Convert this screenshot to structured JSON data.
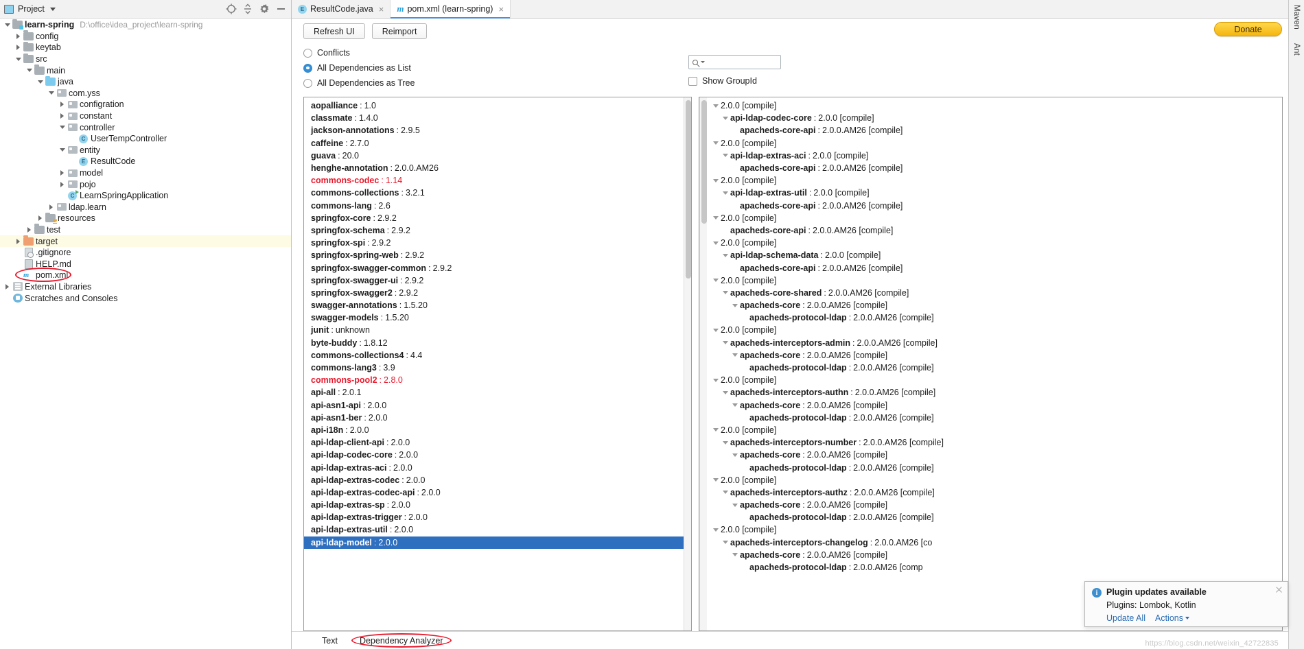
{
  "project_panel": {
    "header": {
      "title": "Project",
      "dropdown_icon": "chevron-down-icon",
      "locate_icon": "locate-icon",
      "collapse_icon": "collapse-all-icon",
      "settings_icon": "gear-icon",
      "hide_icon": "minimize-icon"
    },
    "tree": [
      {
        "label": "learn-spring",
        "path": "D:\\office\\idea_project\\learn-spring",
        "indent": 0,
        "twisty": "open",
        "icon": "module-folder-icon",
        "bold": true,
        "highlight": false
      },
      {
        "label": "config",
        "indent": 1,
        "twisty": "closed",
        "icon": "folder-grey-icon",
        "bold": false,
        "highlight": false
      },
      {
        "label": "keytab",
        "indent": 1,
        "twisty": "closed",
        "icon": "folder-grey-icon",
        "bold": false,
        "highlight": false
      },
      {
        "label": "src",
        "indent": 1,
        "twisty": "open",
        "icon": "folder-grey-icon",
        "bold": false,
        "highlight": false
      },
      {
        "label": "main",
        "indent": 2,
        "twisty": "open",
        "icon": "folder-grey-icon",
        "bold": false,
        "highlight": false
      },
      {
        "label": "java",
        "indent": 3,
        "twisty": "open",
        "icon": "folder-source-icon",
        "bold": false,
        "highlight": false
      },
      {
        "label": "com.yss",
        "indent": 4,
        "twisty": "open",
        "icon": "package-icon",
        "bold": false,
        "highlight": false
      },
      {
        "label": "configration",
        "indent": 5,
        "twisty": "closed",
        "icon": "package-icon",
        "bold": false,
        "highlight": false
      },
      {
        "label": "constant",
        "indent": 5,
        "twisty": "closed",
        "icon": "package-icon",
        "bold": false,
        "highlight": false
      },
      {
        "label": "controller",
        "indent": 5,
        "twisty": "open",
        "icon": "package-icon",
        "bold": false,
        "highlight": false
      },
      {
        "label": "UserTempController",
        "indent": 6,
        "twisty": "none",
        "icon": "class-icon",
        "bold": false,
        "highlight": false
      },
      {
        "label": "entity",
        "indent": 5,
        "twisty": "open",
        "icon": "package-icon",
        "bold": false,
        "highlight": false
      },
      {
        "label": "ResultCode",
        "indent": 6,
        "twisty": "none",
        "icon": "enum-icon",
        "bold": false,
        "highlight": false
      },
      {
        "label": "model",
        "indent": 5,
        "twisty": "closed",
        "icon": "package-icon",
        "bold": false,
        "highlight": false
      },
      {
        "label": "pojo",
        "indent": 5,
        "twisty": "closed",
        "icon": "package-icon",
        "bold": false,
        "highlight": false
      },
      {
        "label": "LearnSpringApplication",
        "indent": 5,
        "twisty": "none",
        "icon": "runnable-class-icon",
        "bold": false,
        "highlight": false
      },
      {
        "label": "ldap.learn",
        "indent": 4,
        "twisty": "closed",
        "icon": "package-icon",
        "bold": false,
        "highlight": false
      },
      {
        "label": "resources",
        "indent": 3,
        "twisty": "closed",
        "icon": "folder-resources-icon",
        "bold": false,
        "highlight": false
      },
      {
        "label": "test",
        "indent": 2,
        "twisty": "closed",
        "icon": "folder-grey-icon",
        "bold": false,
        "highlight": false
      },
      {
        "label": "target",
        "indent": 1,
        "twisty": "closed",
        "icon": "folder-excluded-icon",
        "bold": false,
        "highlight": true
      },
      {
        "label": ".gitignore",
        "indent": 1,
        "twisty": "none",
        "icon": "gitignore-file-icon",
        "bold": false,
        "highlight": false
      },
      {
        "label": "HELP.md",
        "indent": 1,
        "twisty": "none",
        "icon": "markdown-file-icon",
        "bold": false,
        "highlight": false
      },
      {
        "label": "pom.xml",
        "indent": 1,
        "twisty": "none",
        "icon": "maven-file-icon",
        "bold": false,
        "highlight": false,
        "annotated": true
      },
      {
        "label": "External Libraries",
        "indent": 0,
        "twisty": "closed",
        "icon": "library-icon",
        "bold": false,
        "highlight": false
      },
      {
        "label": "Scratches and Consoles",
        "indent": 0,
        "twisty": "none",
        "icon": "scratches-icon",
        "bold": false,
        "highlight": false
      }
    ]
  },
  "editor": {
    "tabs": [
      {
        "label": "ResultCode.java",
        "icon": "enum-file-icon",
        "active": false,
        "closable": true
      },
      {
        "label": "pom.xml (learn-spring)",
        "icon": "maven-file-icon",
        "active": true,
        "closable": true
      }
    ]
  },
  "maven_toolbar": {
    "refresh_label": "Refresh UI",
    "reimport_label": "Reimport",
    "donate_label": "Donate",
    "search_placeholder": "",
    "search_value": "",
    "search_icon": "search-icon",
    "radios": [
      {
        "label": "Conflicts",
        "selected": false
      },
      {
        "label": "All Dependencies as List",
        "selected": true
      },
      {
        "label": "All Dependencies as Tree",
        "selected": false
      }
    ],
    "checkbox": {
      "label": "Show GroupId",
      "checked": false
    }
  },
  "dependency_list": [
    {
      "name": "aopalliance",
      "version": "1.0",
      "conflict": false,
      "selected": false
    },
    {
      "name": "classmate",
      "version": "1.4.0",
      "conflict": false,
      "selected": false
    },
    {
      "name": "jackson-annotations",
      "version": "2.9.5",
      "conflict": false,
      "selected": false
    },
    {
      "name": "caffeine",
      "version": "2.7.0",
      "conflict": false,
      "selected": false
    },
    {
      "name": "guava",
      "version": "20.0",
      "conflict": false,
      "selected": false
    },
    {
      "name": "henghe-annotation",
      "version": "2.0.0.AM26",
      "conflict": false,
      "selected": false
    },
    {
      "name": "commons-codec",
      "version": "1.14",
      "conflict": true,
      "selected": false
    },
    {
      "name": "commons-collections",
      "version": "3.2.1",
      "conflict": false,
      "selected": false
    },
    {
      "name": "commons-lang",
      "version": "2.6",
      "conflict": false,
      "selected": false
    },
    {
      "name": "springfox-core",
      "version": "2.9.2",
      "conflict": false,
      "selected": false
    },
    {
      "name": "springfox-schema",
      "version": "2.9.2",
      "conflict": false,
      "selected": false
    },
    {
      "name": "springfox-spi",
      "version": "2.9.2",
      "conflict": false,
      "selected": false
    },
    {
      "name": "springfox-spring-web",
      "version": "2.9.2",
      "conflict": false,
      "selected": false
    },
    {
      "name": "springfox-swagger-common",
      "version": "2.9.2",
      "conflict": false,
      "selected": false
    },
    {
      "name": "springfox-swagger-ui",
      "version": "2.9.2",
      "conflict": false,
      "selected": false
    },
    {
      "name": "springfox-swagger2",
      "version": "2.9.2",
      "conflict": false,
      "selected": false
    },
    {
      "name": "swagger-annotations",
      "version": "1.5.20",
      "conflict": false,
      "selected": false
    },
    {
      "name": "swagger-models",
      "version": "1.5.20",
      "conflict": false,
      "selected": false
    },
    {
      "name": "junit",
      "version": "unknown",
      "conflict": false,
      "selected": false
    },
    {
      "name": "byte-buddy",
      "version": "1.8.12",
      "conflict": false,
      "selected": false
    },
    {
      "name": "commons-collections4",
      "version": "4.4",
      "conflict": false,
      "selected": false
    },
    {
      "name": "commons-lang3",
      "version": "3.9",
      "conflict": false,
      "selected": false
    },
    {
      "name": "commons-pool2",
      "version": "2.8.0",
      "conflict": true,
      "selected": false
    },
    {
      "name": "api-all",
      "version": "2.0.1",
      "conflict": false,
      "selected": false
    },
    {
      "name": "api-asn1-api",
      "version": "2.0.0",
      "conflict": false,
      "selected": false
    },
    {
      "name": "api-asn1-ber",
      "version": "2.0.0",
      "conflict": false,
      "selected": false
    },
    {
      "name": "api-i18n",
      "version": "2.0.0",
      "conflict": false,
      "selected": false
    },
    {
      "name": "api-ldap-client-api",
      "version": "2.0.0",
      "conflict": false,
      "selected": false
    },
    {
      "name": "api-ldap-codec-core",
      "version": "2.0.0",
      "conflict": false,
      "selected": false
    },
    {
      "name": "api-ldap-extras-aci",
      "version": "2.0.0",
      "conflict": false,
      "selected": false
    },
    {
      "name": "api-ldap-extras-codec",
      "version": "2.0.0",
      "conflict": false,
      "selected": false
    },
    {
      "name": "api-ldap-extras-codec-api",
      "version": "2.0.0",
      "conflict": false,
      "selected": false
    },
    {
      "name": "api-ldap-extras-sp",
      "version": "2.0.0",
      "conflict": false,
      "selected": false
    },
    {
      "name": "api-ldap-extras-trigger",
      "version": "2.0.0",
      "conflict": false,
      "selected": false
    },
    {
      "name": "api-ldap-extras-util",
      "version": "2.0.0",
      "conflict": false,
      "selected": false
    },
    {
      "name": "api-ldap-model",
      "version": "2.0.0",
      "conflict": false,
      "selected": true
    }
  ],
  "dependency_tree": [
    {
      "indent": 0,
      "twisty": "open",
      "name": "",
      "version": "2.0.0 [compile]",
      "bold": false
    },
    {
      "indent": 1,
      "twisty": "open",
      "name": "api-ldap-codec-core",
      "version": "2.0.0 [compile]",
      "bold": true
    },
    {
      "indent": 2,
      "twisty": "none",
      "name": "apacheds-core-api",
      "version": "2.0.0.AM26 [compile]",
      "bold": true
    },
    {
      "indent": 0,
      "twisty": "open",
      "name": "",
      "version": "2.0.0 [compile]",
      "bold": false
    },
    {
      "indent": 1,
      "twisty": "open",
      "name": "api-ldap-extras-aci",
      "version": "2.0.0 [compile]",
      "bold": true
    },
    {
      "indent": 2,
      "twisty": "none",
      "name": "apacheds-core-api",
      "version": "2.0.0.AM26 [compile]",
      "bold": true
    },
    {
      "indent": 0,
      "twisty": "open",
      "name": "",
      "version": "2.0.0 [compile]",
      "bold": false
    },
    {
      "indent": 1,
      "twisty": "open",
      "name": "api-ldap-extras-util",
      "version": "2.0.0 [compile]",
      "bold": true
    },
    {
      "indent": 2,
      "twisty": "none",
      "name": "apacheds-core-api",
      "version": "2.0.0.AM26 [compile]",
      "bold": true
    },
    {
      "indent": 0,
      "twisty": "open",
      "name": "",
      "version": "2.0.0 [compile]",
      "bold": false
    },
    {
      "indent": 1,
      "twisty": "none",
      "name": "apacheds-core-api",
      "version": "2.0.0.AM26 [compile]",
      "bold": true
    },
    {
      "indent": 0,
      "twisty": "open",
      "name": "",
      "version": "2.0.0 [compile]",
      "bold": false
    },
    {
      "indent": 1,
      "twisty": "open",
      "name": "api-ldap-schema-data",
      "version": "2.0.0 [compile]",
      "bold": true
    },
    {
      "indent": 2,
      "twisty": "none",
      "name": "apacheds-core-api",
      "version": "2.0.0.AM26 [compile]",
      "bold": true
    },
    {
      "indent": 0,
      "twisty": "open",
      "name": "",
      "version": "2.0.0 [compile]",
      "bold": false
    },
    {
      "indent": 1,
      "twisty": "open",
      "name": "apacheds-core-shared",
      "version": "2.0.0.AM26 [compile]",
      "bold": true
    },
    {
      "indent": 2,
      "twisty": "open",
      "name": "apacheds-core",
      "version": "2.0.0.AM26 [compile]",
      "bold": true
    },
    {
      "indent": 3,
      "twisty": "none",
      "name": "apacheds-protocol-ldap",
      "version": "2.0.0.AM26 [compile]",
      "bold": true
    },
    {
      "indent": 0,
      "twisty": "open",
      "name": "",
      "version": "2.0.0 [compile]",
      "bold": false
    },
    {
      "indent": 1,
      "twisty": "open",
      "name": "apacheds-interceptors-admin",
      "version": "2.0.0.AM26 [compile]",
      "bold": true
    },
    {
      "indent": 2,
      "twisty": "open",
      "name": "apacheds-core",
      "version": "2.0.0.AM26 [compile]",
      "bold": true
    },
    {
      "indent": 3,
      "twisty": "none",
      "name": "apacheds-protocol-ldap",
      "version": "2.0.0.AM26 [compile]",
      "bold": true
    },
    {
      "indent": 0,
      "twisty": "open",
      "name": "",
      "version": "2.0.0 [compile]",
      "bold": false
    },
    {
      "indent": 1,
      "twisty": "open",
      "name": "apacheds-interceptors-authn",
      "version": "2.0.0.AM26 [compile]",
      "bold": true
    },
    {
      "indent": 2,
      "twisty": "open",
      "name": "apacheds-core",
      "version": "2.0.0.AM26 [compile]",
      "bold": true
    },
    {
      "indent": 3,
      "twisty": "none",
      "name": "apacheds-protocol-ldap",
      "version": "2.0.0.AM26 [compile]",
      "bold": true
    },
    {
      "indent": 0,
      "twisty": "open",
      "name": "",
      "version": "2.0.0 [compile]",
      "bold": false
    },
    {
      "indent": 1,
      "twisty": "open",
      "name": "apacheds-interceptors-number",
      "version": "2.0.0.AM26 [compile]",
      "bold": true
    },
    {
      "indent": 2,
      "twisty": "open",
      "name": "apacheds-core",
      "version": "2.0.0.AM26 [compile]",
      "bold": true
    },
    {
      "indent": 3,
      "twisty": "none",
      "name": "apacheds-protocol-ldap",
      "version": "2.0.0.AM26 [compile]",
      "bold": true
    },
    {
      "indent": 0,
      "twisty": "open",
      "name": "",
      "version": "2.0.0 [compile]",
      "bold": false
    },
    {
      "indent": 1,
      "twisty": "open",
      "name": "apacheds-interceptors-authz",
      "version": "2.0.0.AM26 [compile]",
      "bold": true
    },
    {
      "indent": 2,
      "twisty": "open",
      "name": "apacheds-core",
      "version": "2.0.0.AM26 [compile]",
      "bold": true
    },
    {
      "indent": 3,
      "twisty": "none",
      "name": "apacheds-protocol-ldap",
      "version": "2.0.0.AM26 [compile]",
      "bold": true
    },
    {
      "indent": 0,
      "twisty": "open",
      "name": "",
      "version": "2.0.0 [compile]",
      "bold": false
    },
    {
      "indent": 1,
      "twisty": "open",
      "name": "apacheds-interceptors-changelog",
      "version": "2.0.0.AM26 [co",
      "bold": true
    },
    {
      "indent": 2,
      "twisty": "open",
      "name": "apacheds-core",
      "version": "2.0.0.AM26 [compile]",
      "bold": true
    },
    {
      "indent": 3,
      "twisty": "none",
      "name": "apacheds-protocol-ldap",
      "version": "2.0.0.AM26 [comp",
      "bold": true
    }
  ],
  "bottom_tabs": [
    {
      "label": "Text",
      "active": false,
      "annotated": false
    },
    {
      "label": "Dependency Analyzer",
      "active": true,
      "annotated": true
    }
  ],
  "right_strip": [
    {
      "label": "Maven"
    },
    {
      "label": "Ant"
    }
  ],
  "notification": {
    "title": "Plugin updates available",
    "body": "Plugins: Lombok, Kotlin",
    "action_update": "Update All",
    "action_more": "Actions",
    "info_icon": "info-icon",
    "close_icon": "close-icon",
    "chevron_icon": "chevron-down-icon"
  },
  "watermark": "https://blog.csdn.net/weixin_42722835",
  "colors": {
    "selection_blue": "#2f6fc0",
    "conflict_red": "#e8192c",
    "annotation_red": "#e8192c",
    "donate_yellow": "#f5b60e",
    "accent_blue": "#4a90d9",
    "highlight_yellow": "#fdfbe4"
  }
}
